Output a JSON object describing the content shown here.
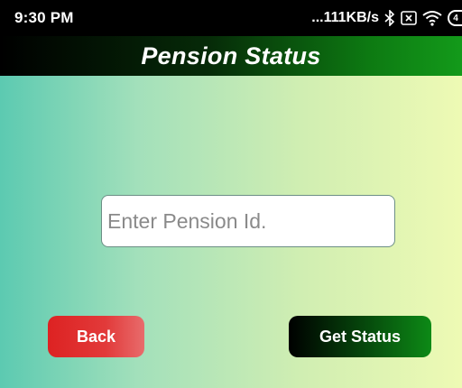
{
  "status_bar": {
    "time": "9:30 PM",
    "network_speed": "...111KB/s",
    "icons": [
      "bluetooth-icon",
      "sim-x-icon",
      "wifi-icon",
      "battery-icon"
    ],
    "battery_level": "4"
  },
  "header": {
    "title": "Pension Status"
  },
  "form": {
    "pension_id": {
      "value": "",
      "placeholder": "Enter Pension Id."
    }
  },
  "actions": {
    "back_label": "Back",
    "get_status_label": "Get Status"
  },
  "colors": {
    "title_bar_start": "#000000",
    "title_bar_end": "#139a1a",
    "background_start": "#5ccab1",
    "background_end": "#eefab4",
    "back_button": "#dd2222",
    "get_status_button": "#0d8a16"
  }
}
